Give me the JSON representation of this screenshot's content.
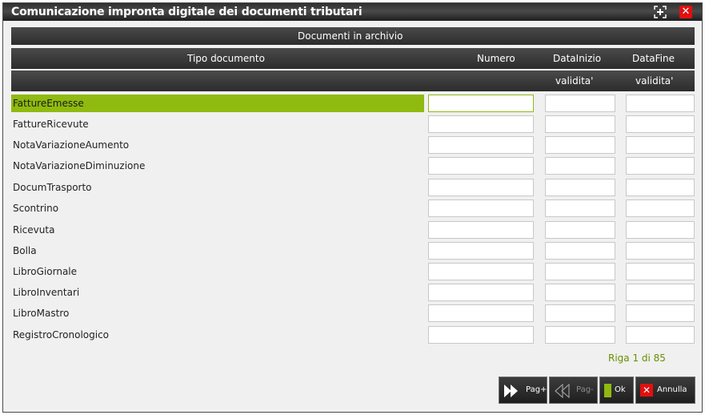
{
  "window": {
    "title": "Comunicazione impronta digitale dei documenti tributari"
  },
  "header": {
    "section": "Documenti in archivio",
    "col_tipo": "Tipo documento",
    "col_numero": "Numero",
    "col_inizio": "DataInizio",
    "col_fine": "DataFine",
    "col_inizio_2": "validita'",
    "col_fine_2": "validita'"
  },
  "rows": [
    "FattureEmesse",
    "FattureRicevute",
    "NotaVariazioneAumento",
    "NotaVariazioneDiminuzione",
    "DocumTrasporto",
    "Scontrino",
    "Ricevuta",
    "Bolla",
    "LibroGiornale",
    "LibroInventari",
    "LibroMastro",
    "RegistroCronologico"
  ],
  "status": {
    "riga": "Riga  1 di 85"
  },
  "buttons": {
    "pag_next": "Pag+",
    "pag_prev": "Pag-",
    "ok": "Ok",
    "annulla": "Annulla"
  },
  "colors": {
    "accent": "#8fba0f",
    "riga_text": "#6a8e00",
    "close": "#e01010"
  }
}
